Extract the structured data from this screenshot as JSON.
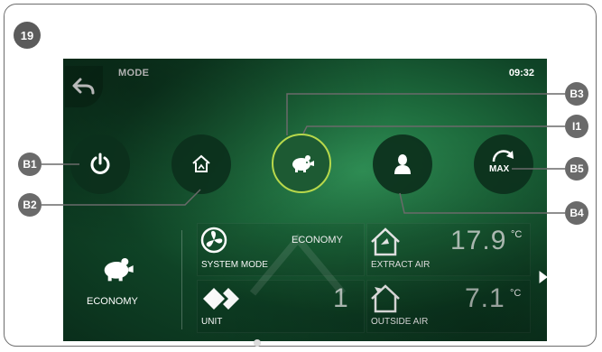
{
  "figure": {
    "number": "19"
  },
  "screen": {
    "title": "MODE",
    "time": "09:32",
    "mode_buttons": [
      {
        "id": "B1",
        "icon": "power-icon"
      },
      {
        "id": "B2",
        "icon": "home-away-icon"
      },
      {
        "id": "B3",
        "icon": "piggy-bank-icon",
        "active": true
      },
      {
        "id": "B4",
        "icon": "person-icon"
      },
      {
        "id": "B5",
        "icon": "max-boost-icon",
        "label": "MAX"
      }
    ],
    "current_mode": {
      "label": "ECONOMY",
      "icon": "piggy-bank-icon"
    },
    "tiles": {
      "system_mode": {
        "label": "SYSTEM MODE",
        "value": "ECONOMY",
        "icon": "fan-icon"
      },
      "unit": {
        "label": "UNIT",
        "value": "1",
        "icon": "diamond-icon"
      },
      "extract_air": {
        "label": "EXTRACT AIR",
        "value": "17.9",
        "unit": "°C",
        "icon": "house-extract-icon"
      },
      "outside_air": {
        "label": "OUTSIDE AIR",
        "value": "7.1",
        "unit": "°C",
        "icon": "house-outside-icon"
      }
    }
  },
  "callouts": [
    "B1",
    "B2",
    "B3",
    "I1",
    "B4",
    "B5"
  ],
  "colors": {
    "active_ring": "#b7d84b",
    "callout": "#6a6a6a",
    "screen_green": "#1d6a3c"
  }
}
